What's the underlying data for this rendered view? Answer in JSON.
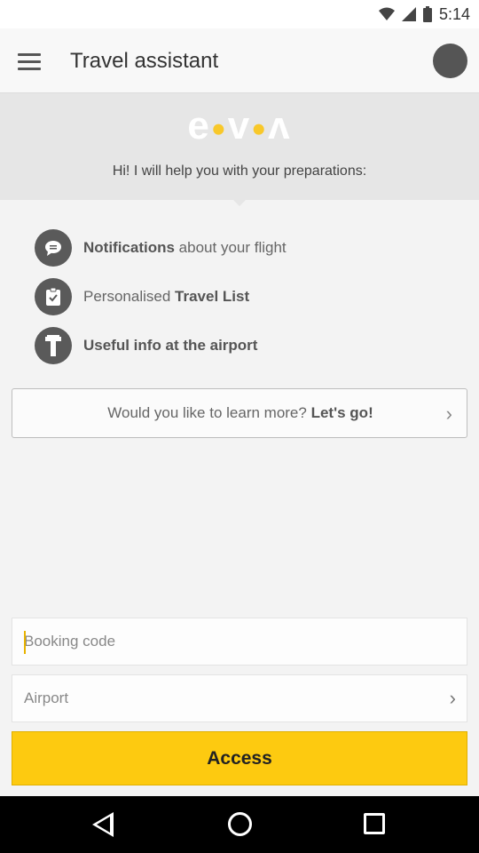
{
  "status": {
    "time": "5:14"
  },
  "appbar": {
    "title": "Travel assistant"
  },
  "hero": {
    "logo": "e·v·ʌ",
    "subtitle": "Hi! I will help you with your preparations:"
  },
  "features": [
    {
      "bold": "Notifications",
      "rest": " about your flight",
      "icon": "chat-icon"
    },
    {
      "prefix": "Personalised ",
      "bold": "Travel List",
      "icon": "clipboard-icon"
    },
    {
      "bold": "Useful info at the airport",
      "icon": "tower-icon"
    }
  ],
  "learn": {
    "text": "Would you like to learn more? ",
    "bold": "Let's go!"
  },
  "form": {
    "booking_placeholder": "Booking code",
    "airport_placeholder": "Airport",
    "access_label": "Access"
  },
  "colors": {
    "accent": "#fdca10",
    "icon_bg": "#5a5a5a"
  }
}
